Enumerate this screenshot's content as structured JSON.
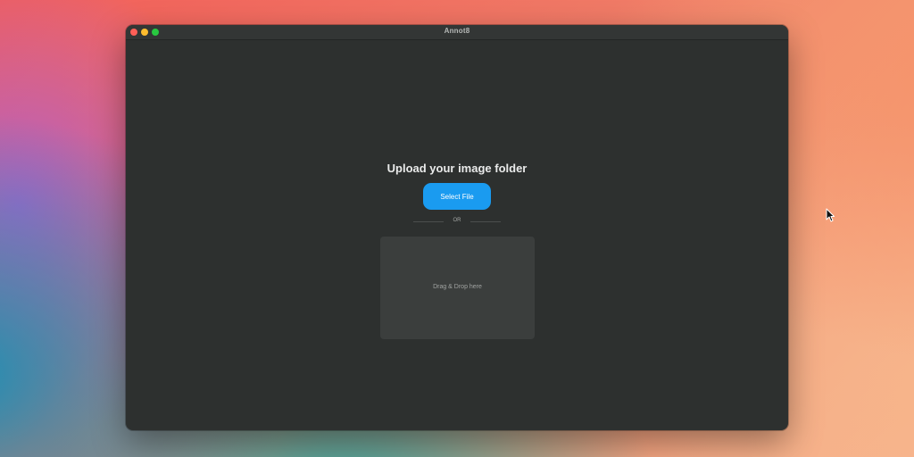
{
  "window": {
    "title": "Annot8"
  },
  "main": {
    "heading": "Upload your image folder",
    "select_file_label": "Select File",
    "or_label": "OR",
    "dropzone_label": "Drag & Drop here"
  },
  "colors": {
    "accent": "#1a9bf0",
    "window_bg": "#2d302f",
    "dropzone_bg": "#3b3e3d"
  },
  "icons": {
    "traffic_lights": [
      "close",
      "minimize",
      "zoom"
    ],
    "pointer": "mouse-pointer-icon"
  }
}
